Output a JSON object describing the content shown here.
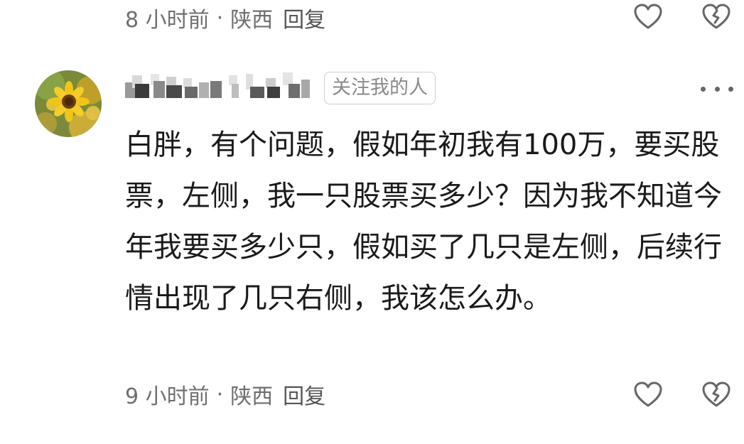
{
  "previous_comment": {
    "time": "8 小时前",
    "separator": "·",
    "location": "陕西",
    "reply_label": "回复"
  },
  "comment": {
    "badge": "关注我的人",
    "text": "白胖，有个问题，假如年初我有100万，要买股票，左侧，我一只股票买多少？因为我不知道今年我要买多少只，假如买了几只是左侧，后续行情出现了几只右侧，我该怎么办。",
    "time": "9 小时前",
    "separator": "·",
    "location": "陕西",
    "reply_label": "回复"
  },
  "icons": {
    "like": "heart-icon",
    "dislike": "broken-heart-icon",
    "more": "more-dots-icon"
  },
  "colors": {
    "meta_text": "#6f6f6f",
    "body_text": "#1a1a1a",
    "icon_stroke": "#666666",
    "badge_border": "#cfcfcf"
  }
}
